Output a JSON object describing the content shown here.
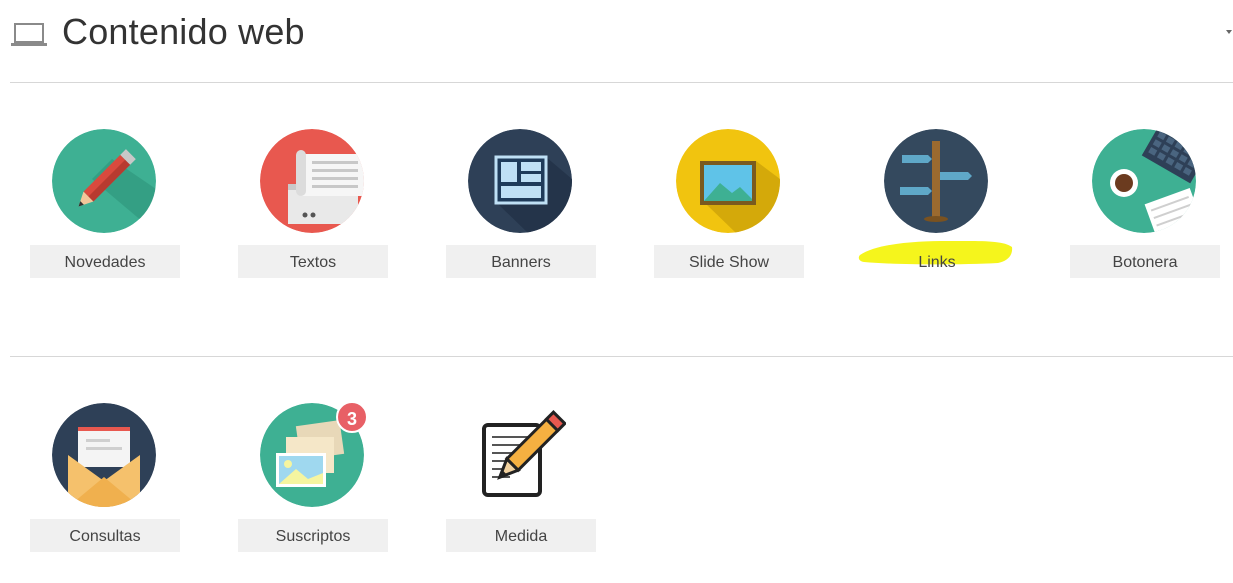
{
  "header": {
    "title": "Contenido web",
    "icon": "laptop-icon"
  },
  "tiles": [
    {
      "label": "Novedades",
      "icon": "pencil-icon",
      "color": "#3eb093"
    },
    {
      "label": "Textos",
      "icon": "document-icon",
      "color": "#e8584f"
    },
    {
      "label": "Banners",
      "icon": "layout-icon",
      "color": "#2e4057"
    },
    {
      "label": "Slide Show",
      "icon": "picture-icon",
      "color": "#f1c40f"
    },
    {
      "label": "Links",
      "icon": "signpost-icon",
      "color": "#34495e",
      "highlighted": true,
      "highlight_color": "#f5f51c"
    },
    {
      "label": "Botonera",
      "icon": "desk-icon",
      "color": "#3eb093"
    },
    {
      "label": "Consultas",
      "icon": "envelope-icon",
      "color": "#2e4057"
    },
    {
      "label": "Suscriptos",
      "icon": "gallery-icon",
      "color": "#3eb093",
      "badge": "3",
      "badge_color": "#e86066"
    },
    {
      "label": "Medida",
      "icon": "edit-document-icon"
    }
  ]
}
